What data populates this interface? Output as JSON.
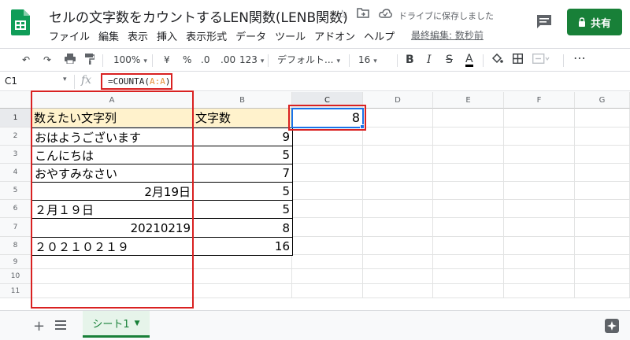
{
  "window": {
    "title": "セルの文字数をカウントするLEN関数(LENB関数)",
    "save_status": "ドライブに保存しました",
    "share_label": "共有",
    "last_edit": "最終編集: 数秒前"
  },
  "menu": [
    "ファイル",
    "編集",
    "表示",
    "挿入",
    "表示形式",
    "データ",
    "ツール",
    "アドオン",
    "ヘルプ"
  ],
  "toolbar": {
    "zoom": "100%",
    "currency": "¥",
    "percent": "%",
    "dec_decrease": ".0",
    "dec_increase": ".00",
    "more_formats": "123",
    "font": "デフォルト...",
    "font_size": "16",
    "bold": "B",
    "italic": "I",
    "strike": "S",
    "text_color": "A",
    "more": "⋯"
  },
  "formula_bar": {
    "cell_ref": "C1",
    "fx": "fx",
    "formula_prefix": "=COUNTA(",
    "formula_ref": "A:A",
    "formula_suffix": ")"
  },
  "columns": [
    "A",
    "B",
    "C",
    "D",
    "E",
    "F",
    "G"
  ],
  "rows": [
    "1",
    "2",
    "3",
    "4",
    "5",
    "6",
    "7",
    "8",
    "9",
    "10",
    "11"
  ],
  "cells": {
    "a1": "数えたい文字列",
    "b1": "文字数",
    "c1": "8",
    "a2": "おはようございます",
    "b2": "9",
    "a3": "こんにちは",
    "b3": "5",
    "a4": "おやすみなさい",
    "b4": "7",
    "a5": "2月19日",
    "b5": "5",
    "a6": "２月１９日",
    "b6": "5",
    "a7": "20210219",
    "b7": "8",
    "a8": "２０２１０２１９",
    "b8": "16"
  },
  "sheet_tab": "シート1",
  "colors": {
    "brand_green": "#188038",
    "highlight_red": "#d92121",
    "header_fill": "#fff2cc",
    "selection_blue": "#1a73e8"
  }
}
